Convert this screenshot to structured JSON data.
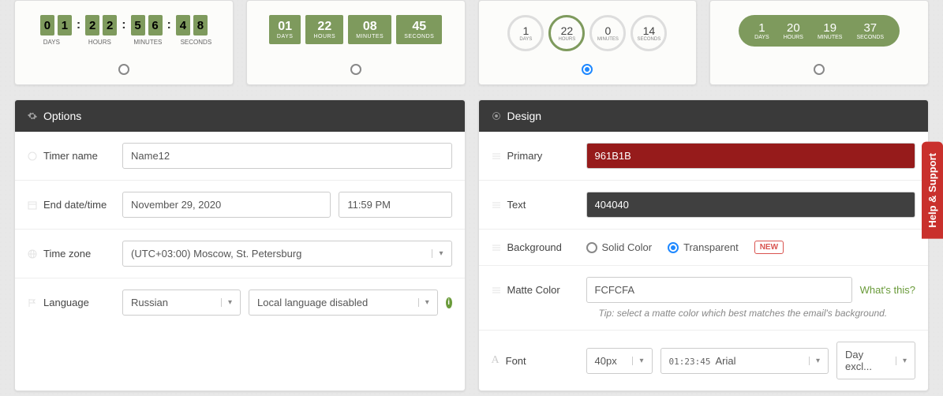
{
  "templates": {
    "t1": {
      "d1": "0",
      "d2": "1",
      "h1": "2",
      "h2": "2",
      "m1": "5",
      "m2": "6",
      "s1": "4",
      "s2": "8",
      "labels": {
        "days": "DAYS",
        "hours": "HOURS",
        "minutes": "MINUTES",
        "seconds": "SECONDS"
      }
    },
    "t2": {
      "days": "01",
      "hours": "22",
      "minutes": "08",
      "seconds": "45",
      "labels": {
        "days": "DAYS",
        "hours": "HOURS",
        "minutes": "MINUTES",
        "seconds": "SECONDS"
      }
    },
    "t3": {
      "days": "1",
      "hours": "22",
      "minutes": "0",
      "seconds": "14",
      "labels": {
        "days": "DAYS",
        "hours": "HOURS",
        "minutes": "MINUTES",
        "seconds": "SECONDS"
      }
    },
    "t4": {
      "days": "1",
      "hours": "20",
      "minutes": "19",
      "seconds": "37",
      "labels": {
        "days": "DAYS",
        "hours": "HOURS",
        "minutes": "MINUTES",
        "seconds": "SECONDS"
      }
    }
  },
  "options": {
    "title": "Options",
    "timer_name": {
      "label": "Timer name",
      "value": "Name12"
    },
    "end_date": {
      "label": "End date/time",
      "date": "November 29, 2020",
      "time": "11:59 PM"
    },
    "timezone": {
      "label": "Time zone",
      "value": "(UTC+03:00) Moscow, St. Petersburg"
    },
    "language": {
      "label": "Language",
      "value": "Russian",
      "local": "Local language disabled"
    }
  },
  "design": {
    "title": "Design",
    "primary": {
      "label": "Primary",
      "value": "961B1B",
      "bg": "#961B1B"
    },
    "text": {
      "label": "Text",
      "value": "404040",
      "bg": "#404040"
    },
    "background": {
      "label": "Background",
      "solid": "Solid Color",
      "transparent": "Transparent",
      "new": "NEW"
    },
    "matte": {
      "label": "Matte Color",
      "value": "FCFCFA",
      "whats_this": "What's this?",
      "tip": "Tip: select a matte color which best matches the email's background."
    },
    "font": {
      "label": "Font",
      "size": "40px",
      "preview": "01:23:45",
      "family": "Arial",
      "excl": "Day excl..."
    }
  },
  "help": "Help & Support"
}
